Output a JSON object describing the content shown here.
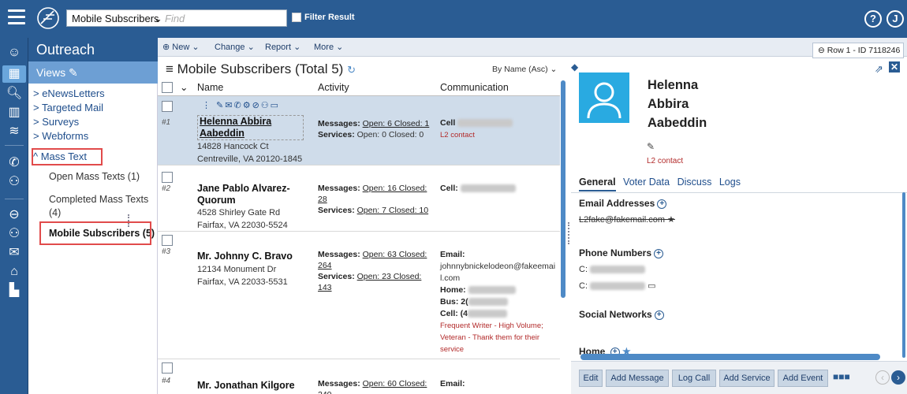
{
  "topbar": {
    "mode_label": "Mobile Subscribers",
    "find_placeholder": "Find",
    "filter_label": "Filter Result",
    "help_icon": "?",
    "user_initial": "J"
  },
  "nav": {
    "title": "Outreach",
    "views_label": "Views",
    "links": [
      "> eNewsLetters",
      "> Targeted Mail",
      "> Surveys",
      "> Webforms",
      "^ Mass Text"
    ],
    "mass_text_items": [
      "Open Mass Texts (1)",
      "Completed Mass Texts (4)",
      "Mobile Subscribers (5)"
    ]
  },
  "toolbar": {
    "new_label": "New",
    "change_label": "Change",
    "report_label": "Report",
    "more_label": "More",
    "row_id": "Row 1 - ID 7118246"
  },
  "list": {
    "title": "Mobile Subscribers (Total 5)",
    "sort": "By Name (Asc)",
    "columns": [
      "Name",
      "Activity",
      "Communication"
    ],
    "rows": [
      {
        "num": "#1",
        "name": "Helenna Abbira Aabeddin",
        "address1": "14828 Hancock Ct",
        "address2": "Centreville, VA 20120-1845",
        "messages_label": "Messages:",
        "messages": "Open: 6 Closed: 1",
        "services_label": "Services:",
        "services": "Open: 0 Closed: 0",
        "comm_label": "Cell",
        "tag": "L2 contact"
      },
      {
        "num": "#2",
        "name": "Jane Pablo Alvarez-Quorum",
        "address1": "4528 Shirley Gate Rd",
        "address2": "Fairfax, VA 22030-5524",
        "messages_label": "Messages:",
        "messages": "Open: 16 Closed: 28",
        "services_label": "Services:",
        "services": "Open: 7 Closed: 10",
        "comm_label": "Cell:"
      },
      {
        "num": "#3",
        "name": "Mr. Johnny C. Bravo",
        "address1": "12134 Monument Dr",
        "address2": "Fairfax, VA 22033-5531",
        "messages_label": "Messages:",
        "messages": "Open: 63 Closed: 264",
        "services_label": "Services:",
        "services": "Open: 23 Closed: 143",
        "email_label": "Email:",
        "email": "johnnybnickelodeon@fakeemail.com",
        "home_label": "Home:",
        "bus_label": "Bus: 2(",
        "cell_label": "Cell: (4",
        "tag": "Frequent Writer - High Volume; Veteran - Thank them for their service"
      },
      {
        "num": "#4",
        "name": "Mr. Jonathan Kilgore",
        "messages_label": "Messages:",
        "messages": "Open: 60 Closed: 240",
        "email_label": "Email:"
      }
    ]
  },
  "detail": {
    "name_lines": [
      "Helenna",
      "Abbira",
      "Aabeddin"
    ],
    "tag": "L2 contact",
    "tabs": [
      "General",
      "Voter Data",
      "Discuss",
      "Logs"
    ],
    "email_section": "Email Addresses",
    "email_value": "L2fake@fakemail.com ★",
    "phone_section": "Phone Numbers",
    "phone_prefix_1": "C:",
    "phone_prefix_2": "C:",
    "social_section": "Social Networks",
    "home_section": "Home",
    "actions": [
      "Edit",
      "Add Message",
      "Log Call",
      "Add Service",
      "Add Event"
    ]
  }
}
